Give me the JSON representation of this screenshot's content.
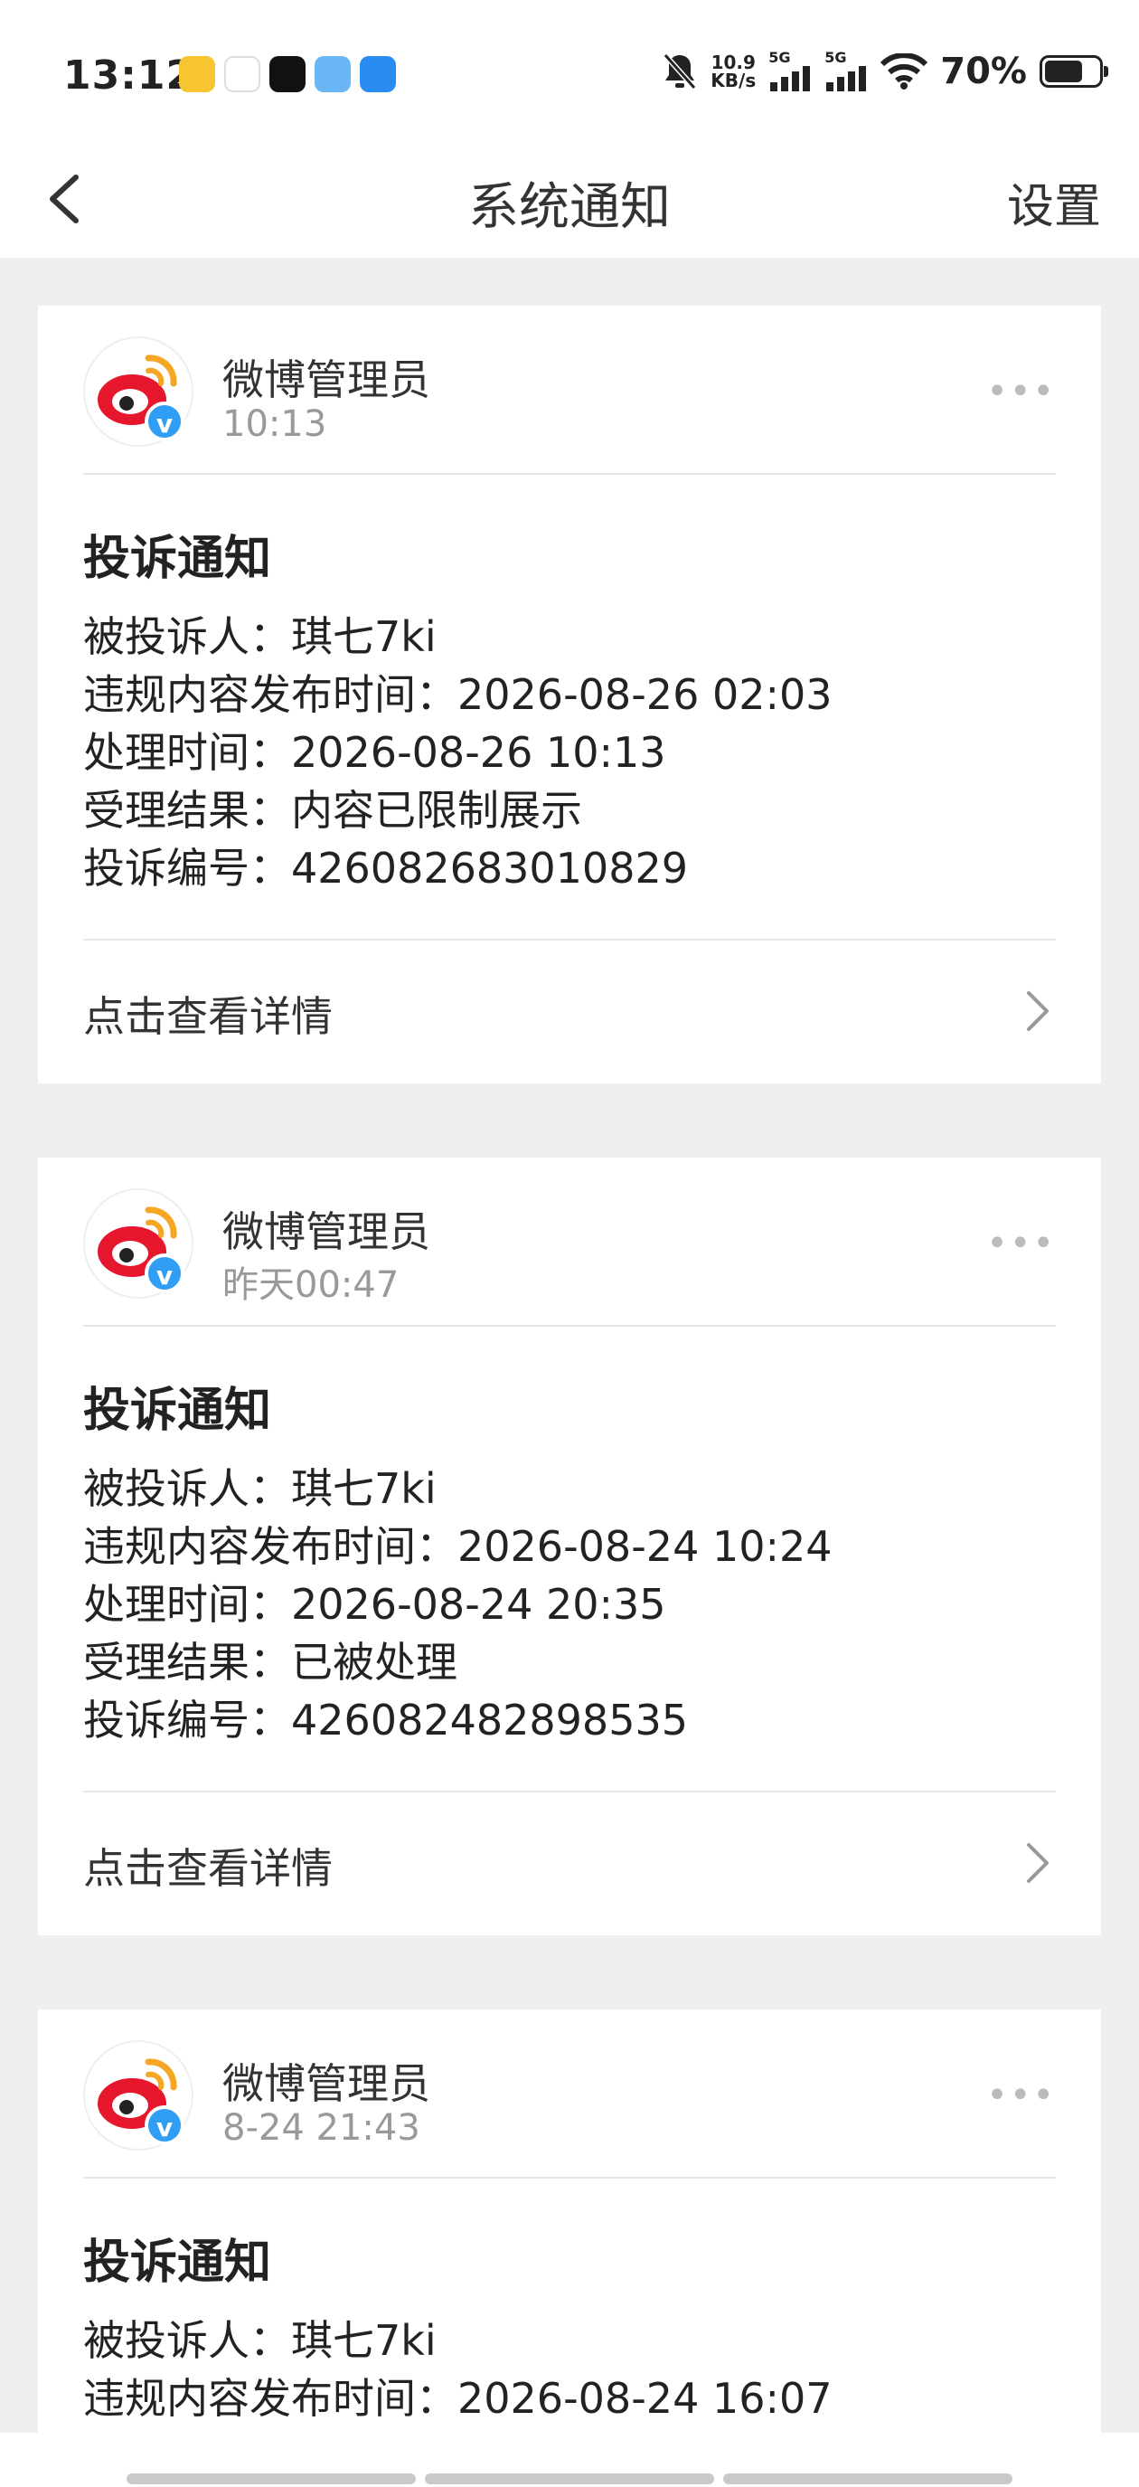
{
  "status": {
    "time": "13:12",
    "net_speed_top": "10.9",
    "net_speed_unit": "KB/s",
    "sig1": "5G",
    "sig2": "5G",
    "battery": "70%",
    "battery_level": 0.7
  },
  "nav": {
    "title": "系统通知",
    "settings": "设置"
  },
  "notifications": [
    {
      "sender": "微博管理员",
      "time": "10:13",
      "title": "投诉通知",
      "lines": [
        "被投诉人：琪七7ki",
        "违规内容发布时间：2026-08-26 02:03",
        "处理时间：2026-08-26 10:13",
        "受理结果：内容已限制展示",
        "投诉编号：426082683010829"
      ],
      "detail": "点击查看详情"
    },
    {
      "sender": "微博管理员",
      "time": "昨天00:47",
      "title": "投诉通知",
      "lines": [
        "被投诉人：琪七7ki",
        "违规内容发布时间：2026-08-24 10:24",
        "处理时间：2026-08-24 20:35",
        "受理结果：已被处理",
        "投诉编号：426082482898535"
      ],
      "detail": "点击查看详情"
    },
    {
      "sender": "微博管理员",
      "time": "8-24 21:43",
      "title": "投诉通知",
      "lines": [
        "被投诉人：琪七7ki",
        "违规内容发布时间：2026-08-24 16:07"
      ]
    }
  ],
  "colors": {
    "verify_badge": "#2f9ef4",
    "weibo_red": "#e6162d",
    "weibo_orange": "#f5a623"
  }
}
